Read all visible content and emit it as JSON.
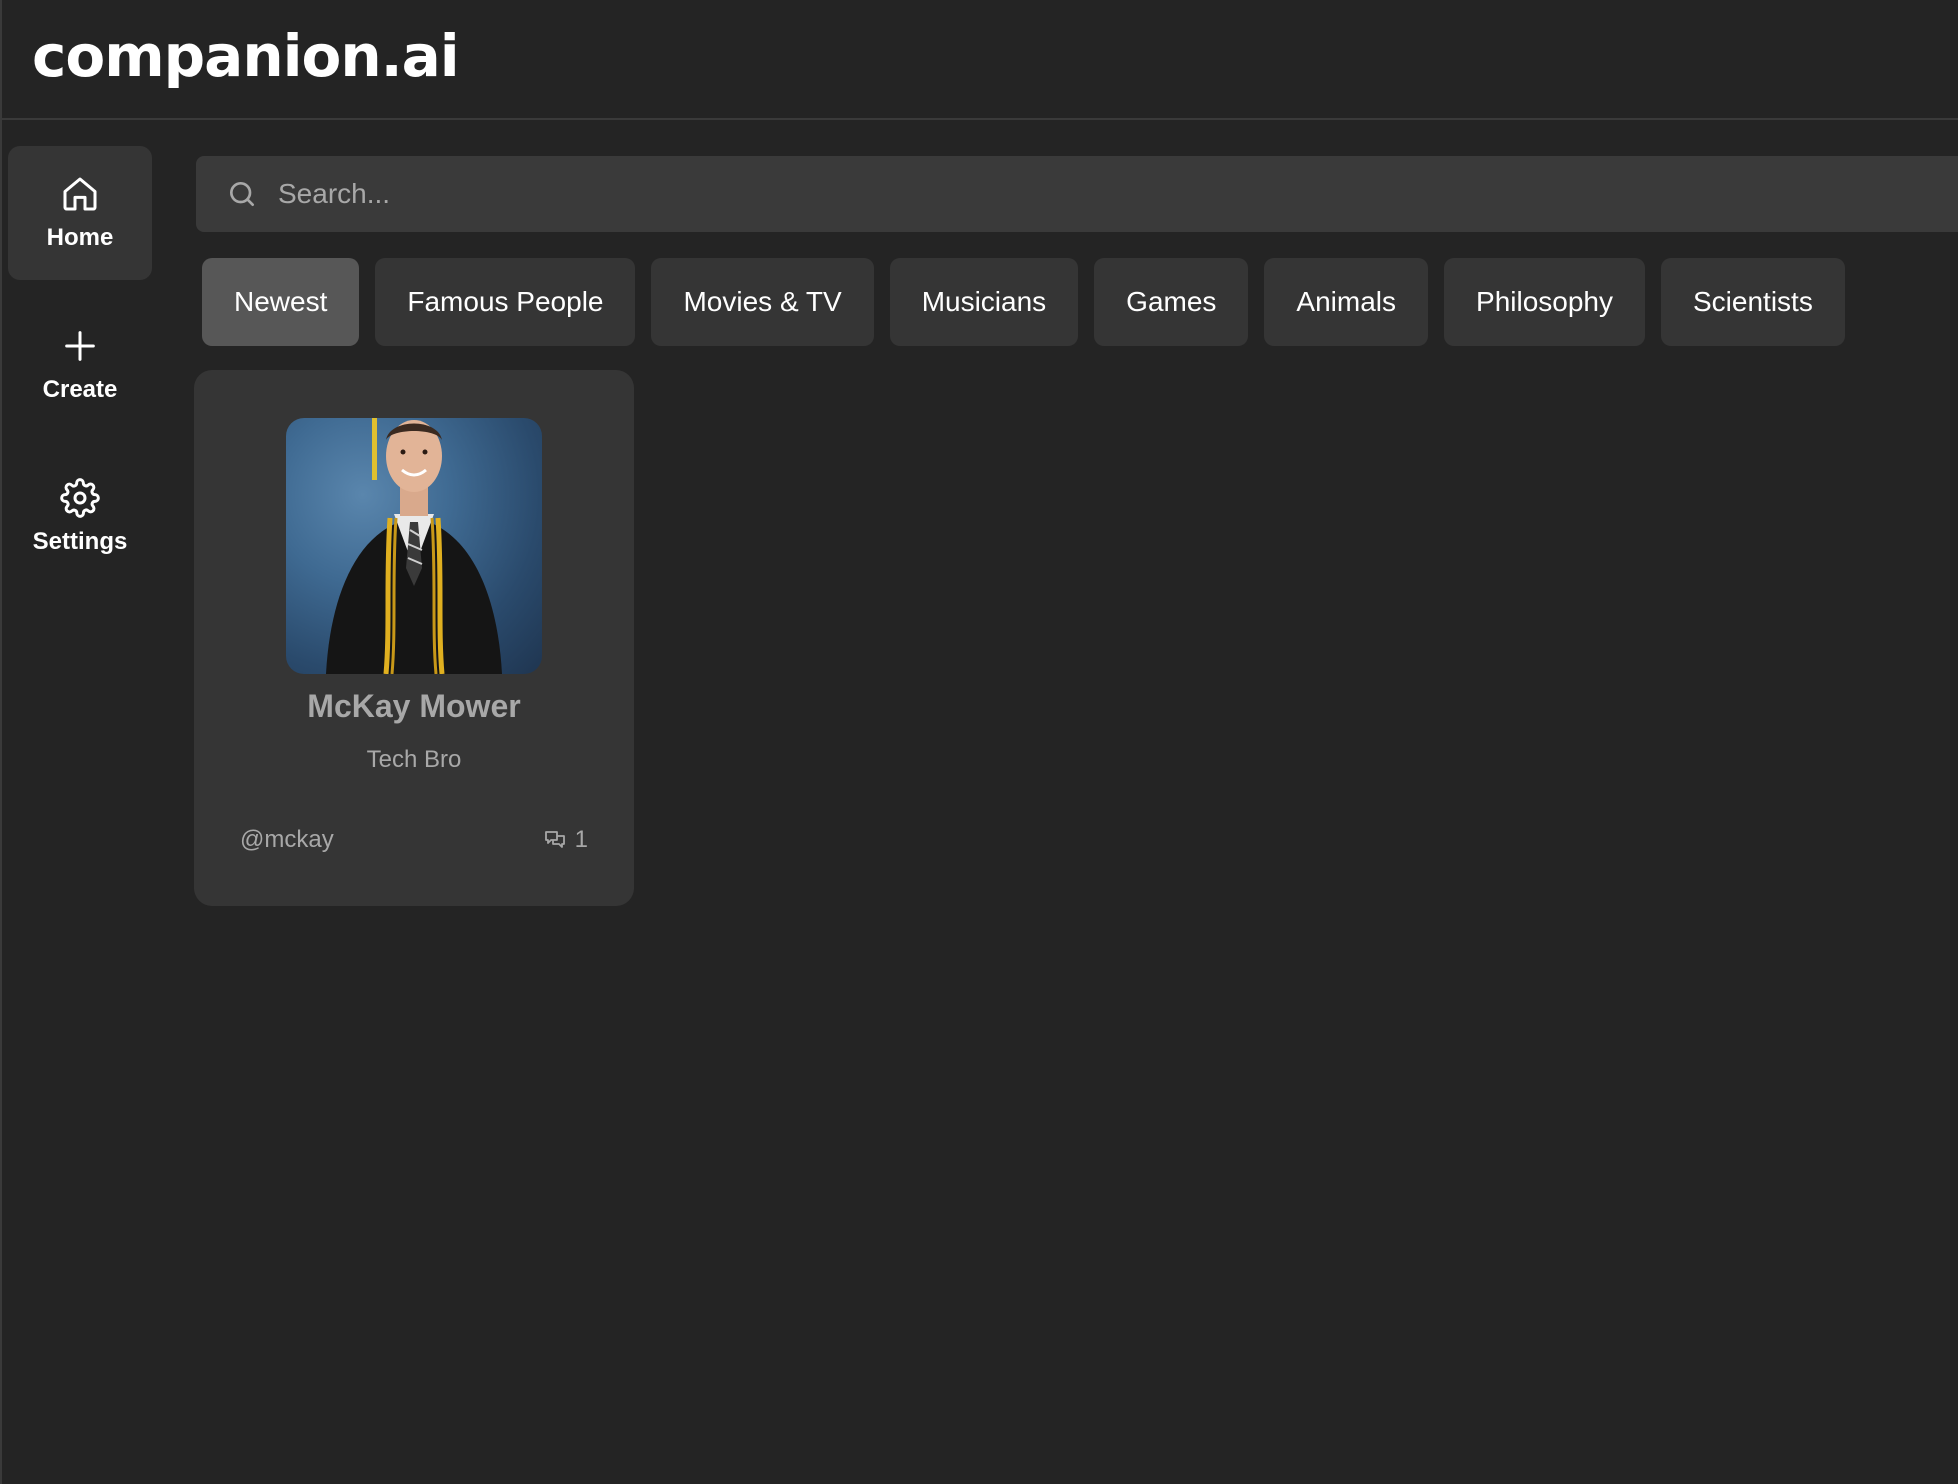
{
  "app": {
    "brand": "companion.ai"
  },
  "sidebar": {
    "items": [
      {
        "label": "Home",
        "icon": "home-icon",
        "active": true
      },
      {
        "label": "Create",
        "icon": "plus-icon",
        "active": false
      },
      {
        "label": "Settings",
        "icon": "gear-icon",
        "active": false
      }
    ]
  },
  "search": {
    "placeholder": "Search...",
    "value": ""
  },
  "categories": [
    {
      "label": "Newest",
      "active": true
    },
    {
      "label": "Famous People",
      "active": false
    },
    {
      "label": "Movies & TV",
      "active": false
    },
    {
      "label": "Musicians",
      "active": false
    },
    {
      "label": "Games",
      "active": false
    },
    {
      "label": "Animals",
      "active": false
    },
    {
      "label": "Philosophy",
      "active": false
    },
    {
      "label": "Scientists",
      "active": false
    }
  ],
  "companions": [
    {
      "name": "McKay Mower",
      "description": "Tech Bro",
      "handle": "@mckay",
      "messages": "1"
    }
  ],
  "colors": {
    "background": "#242424",
    "panel": "#353535",
    "active_chip": "#575757",
    "search_bg": "#3a3a3a",
    "muted_text": "#a8a8a8"
  }
}
